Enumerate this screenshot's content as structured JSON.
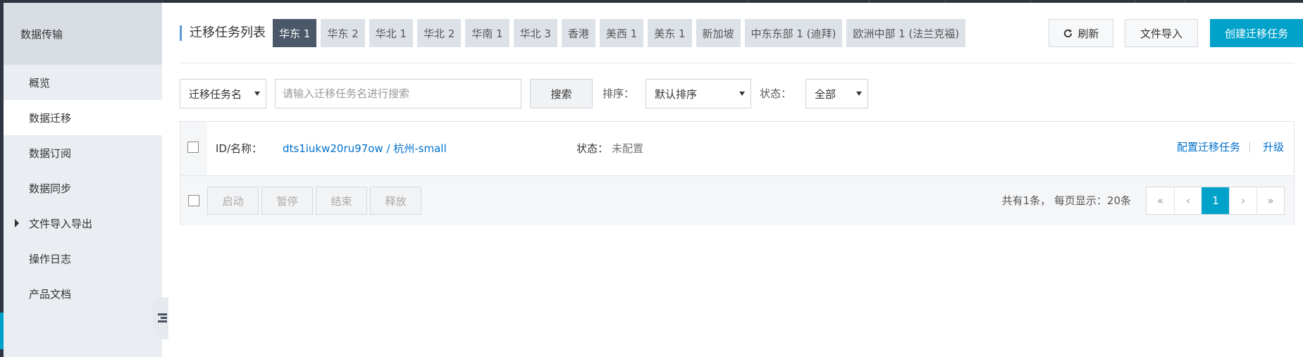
{
  "sidebar": {
    "title": "数据传输",
    "items": [
      {
        "label": "概览"
      },
      {
        "label": "数据迁移"
      },
      {
        "label": "数据订阅"
      },
      {
        "label": "数据同步"
      },
      {
        "label": "文件导入导出"
      },
      {
        "label": "操作日志"
      },
      {
        "label": "产品文档"
      }
    ],
    "active_item": "数据迁移"
  },
  "header": {
    "title": "迁移任务列表",
    "regions": [
      "华东 1",
      "华东 2",
      "华北 1",
      "华北 2",
      "华南 1",
      "华北 3",
      "香港",
      "美西 1",
      "美东 1",
      "新加坡",
      "中东东部 1 (迪拜)",
      "欧洲中部 1 (法兰克福)"
    ],
    "active_region": "华东 1",
    "refresh_label": "刷新",
    "import_label": "文件导入",
    "create_label": "创建迁移任务"
  },
  "filters": {
    "field_select": "迁移任务名",
    "search_placeholder": "请输入迁移任务名进行搜索",
    "search_button": "搜索",
    "sort_label": "排序：",
    "sort_value": "默认排序",
    "status_label": "状态：",
    "status_value": "全部"
  },
  "table": {
    "rows": [
      {
        "id_label": "ID/名称：",
        "id_value": "dts1iukw20ru97ow / 杭州-small",
        "status_label": "状态：",
        "status_value": "未配置",
        "action_config": "配置迁移任务",
        "action_upgrade": "升级"
      }
    ]
  },
  "footer": {
    "start": "启动",
    "pause": "暂停",
    "end": "结束",
    "release": "释放",
    "summary": "共有1条， 每页显示：20条",
    "pager": {
      "first": "«",
      "prev": "‹",
      "current": "1",
      "next": "›",
      "last": "»"
    }
  },
  "colors": {
    "accent": "#00a2ca",
    "link": "#0070cc",
    "active_region_bg": "#4a5869"
  }
}
